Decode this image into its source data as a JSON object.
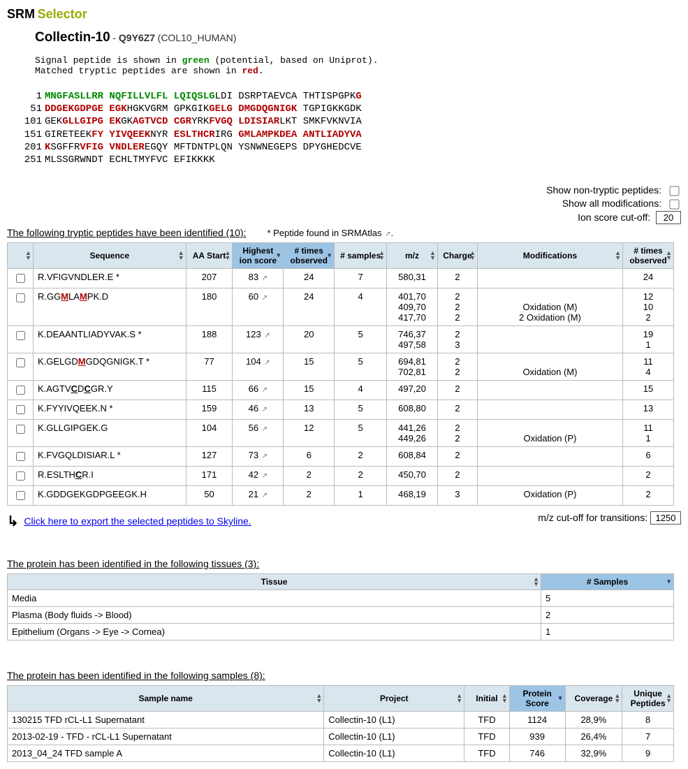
{
  "title": {
    "srm": "SRM",
    "selector": "Selector"
  },
  "protein": {
    "name": "Collectin-10",
    "sep": " - ",
    "accession": "Q9Y6Z7",
    "entry": "(COL10_HUMAN)"
  },
  "notes": {
    "line1_pre": "Signal peptide is shown in ",
    "line1_green": "green",
    "line1_post": " (potential, based on Uniprot).",
    "line2_pre": "Matched tryptic peptides are shown in ",
    "line2_red": "red",
    "line2_post": "."
  },
  "sequence": [
    {
      "pos": "1",
      "chunks": [
        {
          "t": "MNGFASLLRR NQFILLVLFL LQIQSLG",
          "c": "g"
        },
        {
          "t": "LDI DSRPTAEVCA THTISPGPK",
          "c": ""
        },
        {
          "t": "G",
          "c": "r"
        }
      ]
    },
    {
      "pos": "51",
      "chunks": [
        {
          "t": "DDGEKGDPGE EGK",
          "c": "r"
        },
        {
          "t": "HGKVGRM GPKGIK",
          "c": ""
        },
        {
          "t": "GELG DMGDQGNIGK",
          "c": "r"
        },
        {
          "t": " TGPIGKKGDK",
          "c": ""
        }
      ]
    },
    {
      "pos": "101",
      "chunks": [
        {
          "t": "GEK",
          "c": ""
        },
        {
          "t": "GLLGIPG EK",
          "c": "r"
        },
        {
          "t": "GK",
          "c": ""
        },
        {
          "t": "AGTVCD CGR",
          "c": "r"
        },
        {
          "t": "YRK",
          "c": ""
        },
        {
          "t": "FVGQ LDISIAR",
          "c": "r"
        },
        {
          "t": "LKT SMKFVKNVIA",
          "c": ""
        }
      ]
    },
    {
      "pos": "151",
      "chunks": [
        {
          "t": "GIRETEEK",
          "c": ""
        },
        {
          "t": "FY YIVQEEK",
          "c": "r"
        },
        {
          "t": "NYR ",
          "c": ""
        },
        {
          "t": "ESLTHCR",
          "c": "r"
        },
        {
          "t": "IRG ",
          "c": ""
        },
        {
          "t": "GMLAMPKDEA ANTLIADYVA",
          "c": "r"
        }
      ]
    },
    {
      "pos": "201",
      "chunks": [
        {
          "t": "K",
          "c": "r"
        },
        {
          "t": "SGFFR",
          "c": ""
        },
        {
          "t": "VFIG VNDLER",
          "c": "r"
        },
        {
          "t": "EGQY MFTDNTPLQN YSNWNEGEPS DPYGHEDCVE",
          "c": ""
        }
      ]
    },
    {
      "pos": "251",
      "chunks": [
        {
          "t": "MLSSGRWNDT ECHLTMYFVC EFIKKKK",
          "c": ""
        }
      ]
    }
  ],
  "controls": {
    "nontryptic_label": "Show non-tryptic peptides:",
    "allmods_label": "Show all modifications:",
    "ionscore_label": "Ion score cut-off:",
    "ionscore_value": "20"
  },
  "peptide_section": {
    "header": "The following tryptic peptides have been identified (10):",
    "srm_note": "* Peptide found in SRMAtlas"
  },
  "peptide_cols": {
    "chk": "",
    "seq": "Sequence",
    "aastart": "AA Start",
    "highscore": "Highest ion score",
    "timesobs": "# times observed",
    "samples": "# samples",
    "mz": "m/z",
    "charge": "Charge",
    "mods": "Modifications",
    "timesobs2": "# times observed"
  },
  "peptides": [
    {
      "seq_pre": "R.",
      "seq_main": "VFIGVNDLER",
      "seq_post": ".E",
      "star": " *",
      "aa": "207",
      "score": "83",
      "obs": "24",
      "samp": "7",
      "mz": [
        "580,31"
      ],
      "chg": [
        "2"
      ],
      "mods": [
        ""
      ],
      "obs2": [
        "24"
      ]
    },
    {
      "seq_pre": "R.",
      "seq_main": "GG<U1>M</U1>LA<U1>M</U1>PK",
      "seq_post": ".D",
      "star": "",
      "aa": "180",
      "score": "60",
      "obs": "24",
      "samp": "4",
      "mz": [
        "401,70",
        "409,70",
        "417,70"
      ],
      "chg": [
        "2",
        "2",
        "2"
      ],
      "mods": [
        "",
        "Oxidation (M)",
        "2 Oxidation (M)"
      ],
      "obs2": [
        "12",
        "10",
        "2"
      ]
    },
    {
      "seq_pre": "K.",
      "seq_main": "DEAANTLIADYVAK",
      "seq_post": ".S",
      "star": " *",
      "aa": "188",
      "score": "123",
      "obs": "20",
      "samp": "5",
      "mz": [
        "746,37",
        "497,58"
      ],
      "chg": [
        "2",
        "3"
      ],
      "mods": [
        "",
        ""
      ],
      "obs2": [
        "19",
        "1"
      ]
    },
    {
      "seq_pre": "K.",
      "seq_main": "GELGD<U1>M</U1>GDQGNIGK",
      "seq_post": ".T",
      "star": " *",
      "aa": "77",
      "score": "104",
      "obs": "15",
      "samp": "5",
      "mz": [
        "694,81",
        "702,81"
      ],
      "chg": [
        "2",
        "2"
      ],
      "mods": [
        "",
        "Oxidation (M)"
      ],
      "obs2": [
        "11",
        "4"
      ]
    },
    {
      "seq_pre": "K.",
      "seq_main": "AGTV<U2>C</U2>D<U2>C</U2>GR",
      "seq_post": ".Y",
      "star": "",
      "aa": "115",
      "score": "66",
      "obs": "15",
      "samp": "4",
      "mz": [
        "497,20"
      ],
      "chg": [
        "2"
      ],
      "mods": [
        ""
      ],
      "obs2": [
        "15"
      ]
    },
    {
      "seq_pre": "K.",
      "seq_main": "FYYIVQEEK",
      "seq_post": ".N",
      "star": " *",
      "aa": "159",
      "score": "46",
      "obs": "13",
      "samp": "5",
      "mz": [
        "608,80"
      ],
      "chg": [
        "2"
      ],
      "mods": [
        ""
      ],
      "obs2": [
        "13"
      ]
    },
    {
      "seq_pre": "K.",
      "seq_main": "GLLGIPGEK",
      "seq_post": ".G",
      "star": "",
      "aa": "104",
      "score": "56",
      "obs": "12",
      "samp": "5",
      "mz": [
        "441,26",
        "449,26"
      ],
      "chg": [
        "2",
        "2"
      ],
      "mods": [
        "",
        "Oxidation (P)"
      ],
      "obs2": [
        "11",
        "1"
      ]
    },
    {
      "seq_pre": "K.",
      "seq_main": "FVGQLDISIAR",
      "seq_post": ".L",
      "star": " *",
      "aa": "127",
      "score": "73",
      "obs": "6",
      "samp": "2",
      "mz": [
        "608,84"
      ],
      "chg": [
        "2"
      ],
      "mods": [
        ""
      ],
      "obs2": [
        "6"
      ]
    },
    {
      "seq_pre": "R.",
      "seq_main": "ESLTH<U2>C</U2>R",
      "seq_post": ".I",
      "star": "",
      "aa": "171",
      "score": "42",
      "obs": "2",
      "samp": "2",
      "mz": [
        "450,70"
      ],
      "chg": [
        "2"
      ],
      "mods": [
        ""
      ],
      "obs2": [
        "2"
      ]
    },
    {
      "seq_pre": "K.",
      "seq_main": "GDDGEKGDPGEEGK",
      "seq_post": ".H",
      "star": "",
      "aa": "50",
      "score": "21",
      "obs": "2",
      "samp": "1",
      "mz": [
        "468,19"
      ],
      "chg": [
        "3"
      ],
      "mods": [
        "Oxidation (P)"
      ],
      "obs2": [
        "2"
      ]
    }
  ],
  "export": {
    "link": "Click here to export the selected peptides to Skyline.",
    "mz_label": "m/z cut-off for transitions:",
    "mz_value": "1250"
  },
  "tissue_section": {
    "header": "The protein has been identified in the following tissues (3):",
    "cols": {
      "tissue": "Tissue",
      "samples": "# Samples"
    },
    "rows": [
      {
        "tissue": "Media",
        "samples": "5"
      },
      {
        "tissue": "Plasma (Body fluids -> Blood)",
        "samples": "2"
      },
      {
        "tissue": "Epithelium (Organs -> Eye -> Cornea)",
        "samples": "1"
      }
    ]
  },
  "sample_section": {
    "header": "The protein has been identified in the following samples (8):",
    "cols": {
      "name": "Sample name",
      "project": "Project",
      "initial": "Initial",
      "score": "Protein Score",
      "coverage": "Coverage",
      "unique": "Unique Peptides"
    },
    "rows": [
      {
        "name": "130215 TFD rCL-L1 Supernatant",
        "project": "Collectin-10 (L1)",
        "initial": "TFD",
        "score": "1124",
        "coverage": "28,9%",
        "unique": "8"
      },
      {
        "name": "2013-02-19 - TFD - rCL-L1 Supernatant",
        "project": "Collectin-10 (L1)",
        "initial": "TFD",
        "score": "939",
        "coverage": "26,4%",
        "unique": "7"
      },
      {
        "name": "2013_04_24 TFD sample A",
        "project": "Collectin-10 (L1)",
        "initial": "TFD",
        "score": "746",
        "coverage": "32,9%",
        "unique": "9"
      }
    ]
  }
}
